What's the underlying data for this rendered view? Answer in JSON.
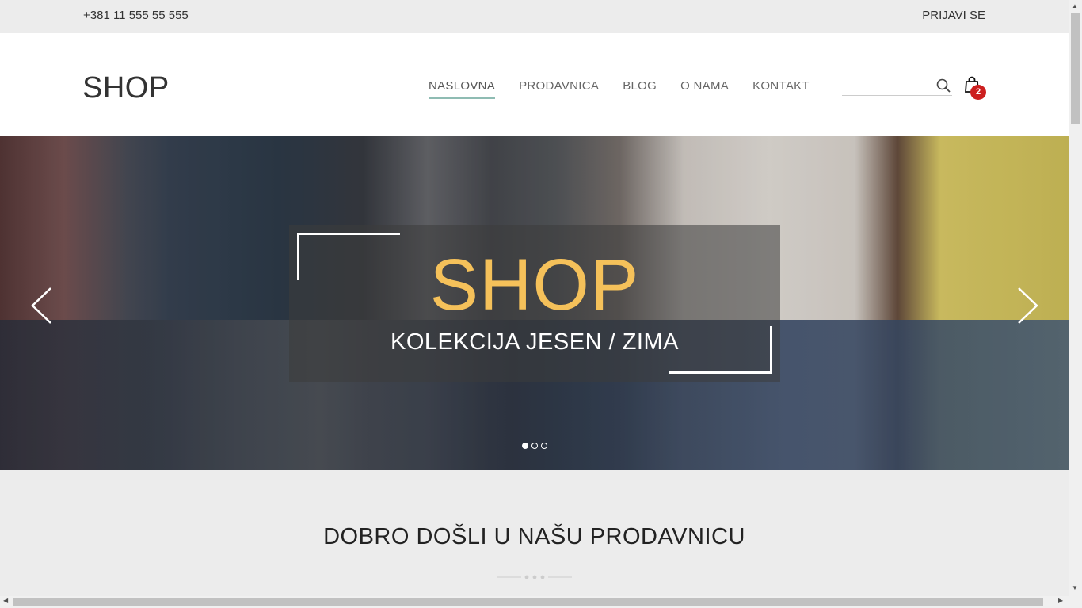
{
  "topbar": {
    "phone": "+381 11 555 55 555",
    "login": "PRIJAVI SE"
  },
  "header": {
    "logo": "SHOP",
    "nav": [
      {
        "label": "NASLOVNA",
        "active": true
      },
      {
        "label": "PRODAVNICA",
        "active": false
      },
      {
        "label": "BLOG",
        "active": false
      },
      {
        "label": "O NAMA",
        "active": false
      },
      {
        "label": "KONTAKT",
        "active": false
      }
    ],
    "search_value": "",
    "search_icon": "search-icon",
    "cart_icon": "shopping-bag-icon",
    "cart_count": "2",
    "cart_badge_color": "#cc1f1f",
    "active_underline_color": "#8fbcb3"
  },
  "hero": {
    "title": "SHOP",
    "subtitle": "KOLEKCIJA JESEN / ZIMA",
    "title_color": "#f5c15a",
    "prev_icon": "chevron-left-icon",
    "next_icon": "chevron-right-icon",
    "slide_count": 3,
    "active_slide": 1
  },
  "welcome": {
    "title": "DOBRO DOŠLI U NAŠU PRODAVNICU"
  }
}
